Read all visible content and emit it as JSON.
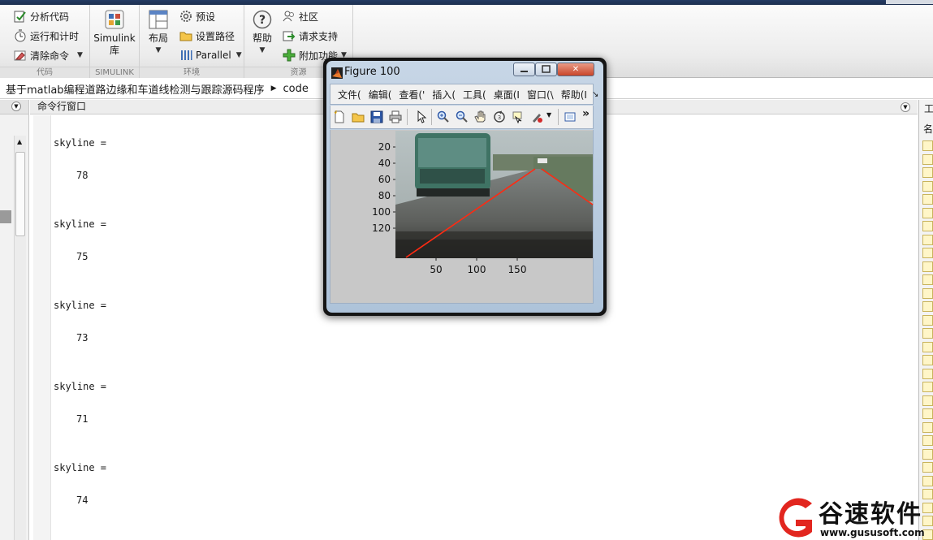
{
  "ribbon": {
    "code_group": {
      "analyze_label": "分析代码",
      "run_time_label": "运行和计时",
      "clear_label": "清除命令",
      "group_label": "代码"
    },
    "simulink_group": {
      "library_label_1": "Simulink",
      "library_label_2": "库",
      "group_label": "SIMULINK"
    },
    "env_group": {
      "layout_label": "布局",
      "preferences_label": "预设",
      "set_path_label": "设置路径",
      "parallel_label": "Parallel",
      "group_label": "环境"
    },
    "resources_group": {
      "help_label": "帮助",
      "community_label": "社区",
      "support_label": "请求支持",
      "addons_label": "附加功能",
      "group_label": "资源"
    }
  },
  "address_bar": {
    "path_folder": "基于matlab编程道路边缘和车道线检测与跟踪源码程序",
    "path_sub": "code"
  },
  "command_window": {
    "title": "命令行窗口",
    "outputs": [
      {
        "var": "skyline =",
        "value": "78"
      },
      {
        "var": "skyline =",
        "value": "75"
      },
      {
        "var": "skyline =",
        "value": "73"
      },
      {
        "var": "skyline =",
        "value": "71"
      },
      {
        "var": "skyline =",
        "value": "74"
      }
    ]
  },
  "right_panel": {
    "header_glyph": "工",
    "sub_glyph": "名"
  },
  "figure": {
    "title": "Figure 100",
    "menus": [
      "文件(",
      "编辑(",
      "查看('",
      "插入(",
      "工具(",
      "桌面(I",
      "窗口(\\",
      "帮助(I"
    ],
    "menu_overflow": "↘",
    "toolbar_overflow": "»",
    "y_ticks": [
      "20",
      "40",
      "60",
      "80",
      "100",
      "120"
    ],
    "x_ticks": [
      "50",
      "100",
      "150"
    ]
  },
  "watermark": {
    "brand": "谷速软件",
    "url": "www.gususoft.com"
  }
}
